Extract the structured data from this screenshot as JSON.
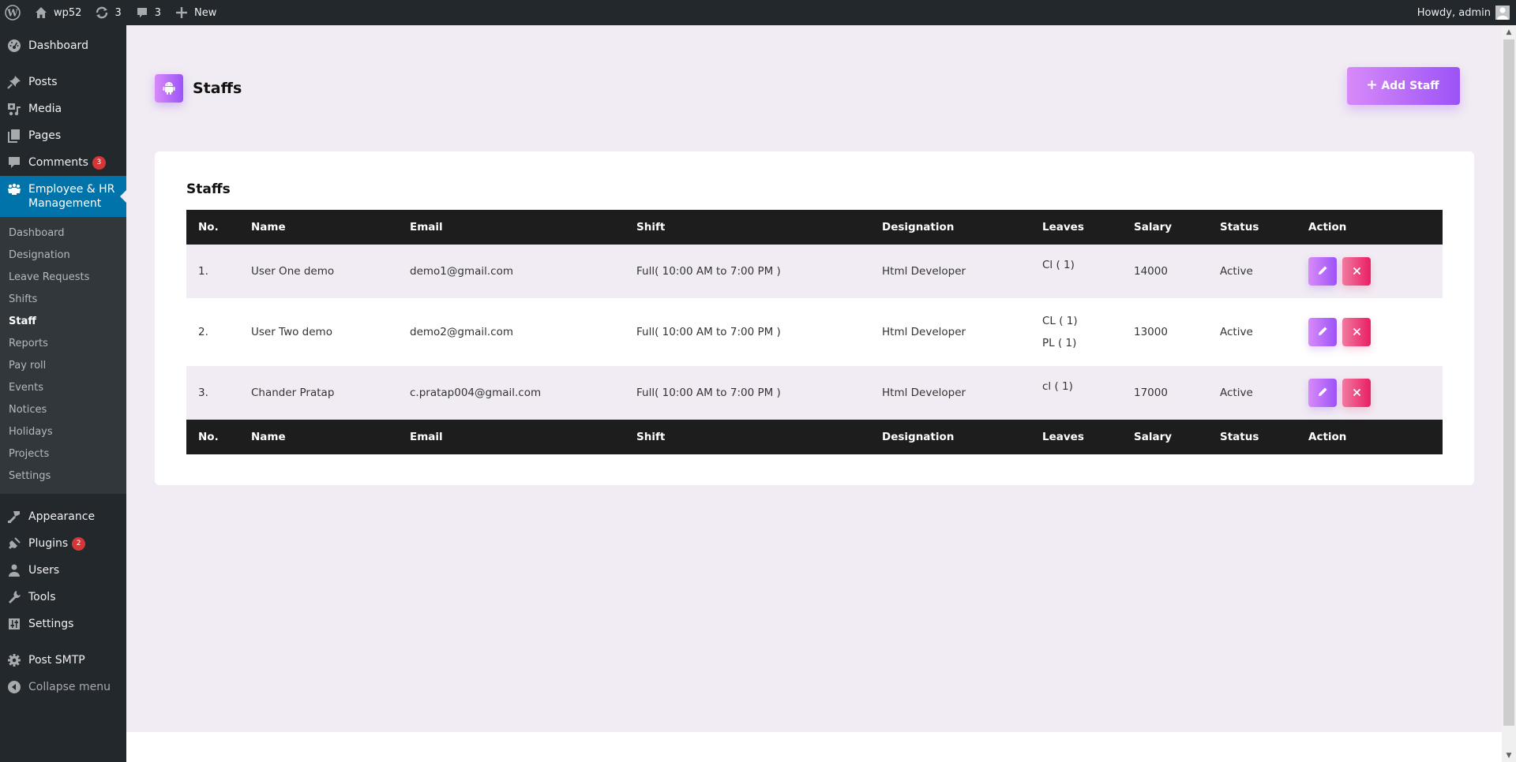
{
  "adminbar": {
    "site_name": "wp52",
    "updates_count": "3",
    "comments_count": "3",
    "new_label": "New",
    "greeting": "Howdy, admin"
  },
  "sidebar": {
    "items": [
      {
        "label": "Dashboard",
        "icon": "dashboard-icon"
      },
      {
        "label": "Posts",
        "icon": "pin-icon"
      },
      {
        "label": "Media",
        "icon": "media-icon"
      },
      {
        "label": "Pages",
        "icon": "pages-icon"
      },
      {
        "label": "Comments",
        "icon": "comment-icon",
        "badge": "3"
      },
      {
        "label": "Employee & HR Management",
        "icon": "groups-icon",
        "current": true
      },
      {
        "label": "Appearance",
        "icon": "paintbrush-icon"
      },
      {
        "label": "Plugins",
        "icon": "plugin-icon",
        "badge": "2"
      },
      {
        "label": "Users",
        "icon": "user-icon"
      },
      {
        "label": "Tools",
        "icon": "wrench-icon"
      },
      {
        "label": "Settings",
        "icon": "sliders-icon"
      },
      {
        "label": "Post SMTP",
        "icon": "gear-icon"
      },
      {
        "label": "Collapse menu",
        "icon": "collapse-icon"
      }
    ],
    "submenu": [
      "Dashboard",
      "Designation",
      "Leave Requests",
      "Shifts",
      "Staff",
      "Reports",
      "Pay roll",
      "Events",
      "Notices",
      "Holidays",
      "Projects",
      "Settings"
    ],
    "submenu_current": "Staff"
  },
  "page": {
    "title": "Staffs",
    "add_button": "Add Staff",
    "card_title": "Staffs"
  },
  "table": {
    "columns": [
      "No.",
      "Name",
      "Email",
      "Shift",
      "Designation",
      "Leaves",
      "Salary",
      "Status",
      "Action"
    ],
    "rows": [
      {
        "no": "1.",
        "name": "User One demo",
        "email": "demo1@gmail.com",
        "shift": "Full( 10:00 AM to 7:00 PM )",
        "designation": "Html Developer",
        "leaves": [
          "Cl ( 1)"
        ],
        "salary": "14000",
        "status": "Active"
      },
      {
        "no": "2.",
        "name": "User Two demo",
        "email": "demo2@gmail.com",
        "shift": "Full( 10:00 AM to 7:00 PM )",
        "designation": "Html Developer",
        "leaves": [
          "CL ( 1)",
          "PL ( 1)"
        ],
        "salary": "13000",
        "status": "Active"
      },
      {
        "no": "3.",
        "name": "Chander Pratap",
        "email": "c.pratap004@gmail.com",
        "shift": "Full( 10:00 AM to 7:00 PM )",
        "designation": "Html Developer",
        "leaves": [
          "cl ( 1)"
        ],
        "salary": "17000",
        "status": "Active"
      }
    ]
  },
  "colors": {
    "admin_bar": "#23282d",
    "sidebar_active": "#0073aa",
    "accent_gradient_start": "#d88af9",
    "accent_gradient_end": "#9c53f7",
    "delete_gradient_start": "#f07aa0",
    "delete_gradient_end": "#ea1e63",
    "page_bg": "#f1ecf3",
    "table_header": "#1d1d1d",
    "badge": "#d63638"
  }
}
